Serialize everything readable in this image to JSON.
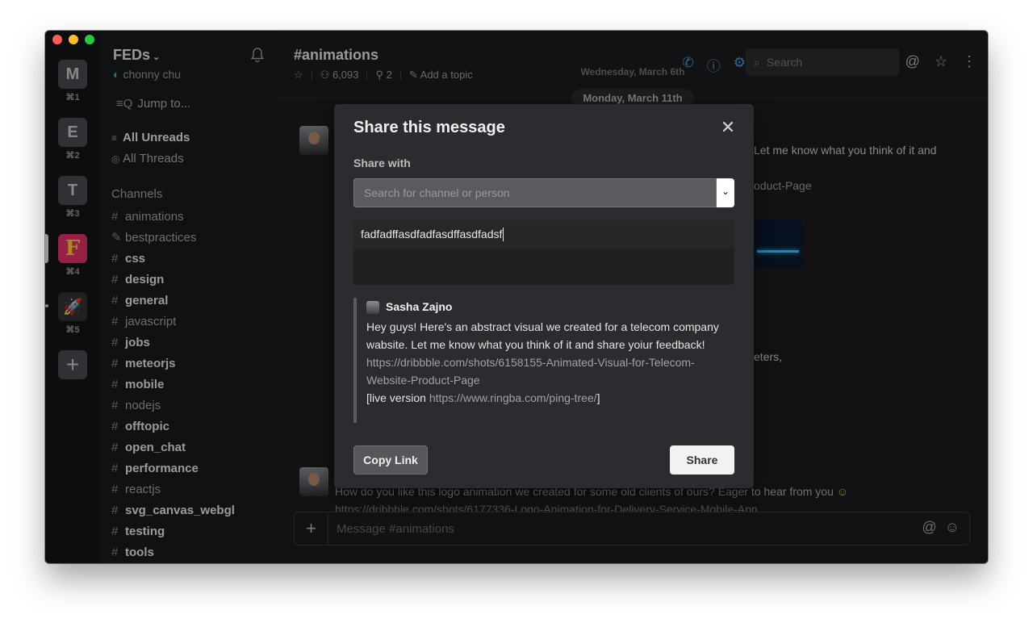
{
  "colors": {
    "accent": "#4a9de0",
    "modal_bg": "#2b2c2f",
    "sidebar_bg": "#1a1b1d",
    "rail_bg": "#141517"
  },
  "workspaces": [
    {
      "letter": "M",
      "shortcut": "⌘1"
    },
    {
      "letter": "E",
      "shortcut": "⌘2"
    },
    {
      "letter": "T",
      "shortcut": "⌘3"
    },
    {
      "letter": "F",
      "shortcut": "⌘4",
      "icon": "fed-logo-icon"
    },
    {
      "letter": "🚀",
      "shortcut": "⌘5",
      "icon": "rocket-icon"
    }
  ],
  "sidebar": {
    "team_name": "FEDs",
    "user_name": "chonny chu",
    "jump_to": "Jump to...",
    "all_unreads": "All Unreads",
    "all_threads": "All Threads",
    "channels_heading": "Channels",
    "channels": [
      {
        "name": "animations",
        "unread": false,
        "icon": "#"
      },
      {
        "name": "bestpractices",
        "unread": false,
        "icon": "✎"
      },
      {
        "name": "css",
        "unread": true,
        "icon": "#"
      },
      {
        "name": "design",
        "unread": true,
        "icon": "#"
      },
      {
        "name": "general",
        "unread": true,
        "icon": "#"
      },
      {
        "name": "javascript",
        "unread": false,
        "icon": "#"
      },
      {
        "name": "jobs",
        "unread": true,
        "icon": "#"
      },
      {
        "name": "meteorjs",
        "unread": true,
        "icon": "#"
      },
      {
        "name": "mobile",
        "unread": true,
        "icon": "#"
      },
      {
        "name": "nodejs",
        "unread": false,
        "icon": "#"
      },
      {
        "name": "offtopic",
        "unread": true,
        "icon": "#"
      },
      {
        "name": "open_chat",
        "unread": true,
        "icon": "#"
      },
      {
        "name": "performance",
        "unread": true,
        "icon": "#"
      },
      {
        "name": "reactjs",
        "unread": false,
        "icon": "#"
      },
      {
        "name": "svg_canvas_webgl",
        "unread": true,
        "icon": "#"
      },
      {
        "name": "testing",
        "unread": true,
        "icon": "#"
      },
      {
        "name": "tools",
        "unread": true,
        "icon": "#"
      }
    ]
  },
  "header": {
    "channel_title": "#animations",
    "members": "6,093",
    "pins": "2",
    "add_topic": "Add a topic",
    "search_placeholder": "Search"
  },
  "messages": {
    "date_prev": "Wednesday, March 6th",
    "date_current": "Monday, March 11th",
    "fragment_1": "Let me know what you think of it and",
    "fragment_2": "oduct-Page",
    "fragment_3": "eters,",
    "second_message": "How do you like this logo animation we created for some old clients of ours? Eager to hear from you",
    "second_link": "https://dribbble.com/shots/6177336-Logo-Animation-for-Delivery-Service-Mobile-App",
    "composer_placeholder": "Message #animations"
  },
  "modal": {
    "title": "Share this message",
    "share_with_label": "Share with",
    "share_select_placeholder": "Search for channel or person",
    "message_value": "fadfadffasdfadfasdffasdfadsf",
    "quote": {
      "author": "Sasha Zajno",
      "text": "Hey guys! Here's an abstract visual we created for a telecom company wabsite. Let me know what you think of it and share yoiur feedback!",
      "link": "https://dribbble.com/shots/6158155-Animated-Visual-for-Telecom-Website-Product-Page",
      "live_prefix": "[live version ",
      "live_link": "https://www.ringba.com/ping-tree/",
      "live_suffix": "]"
    },
    "copy_link_label": "Copy Link",
    "share_label": "Share"
  }
}
